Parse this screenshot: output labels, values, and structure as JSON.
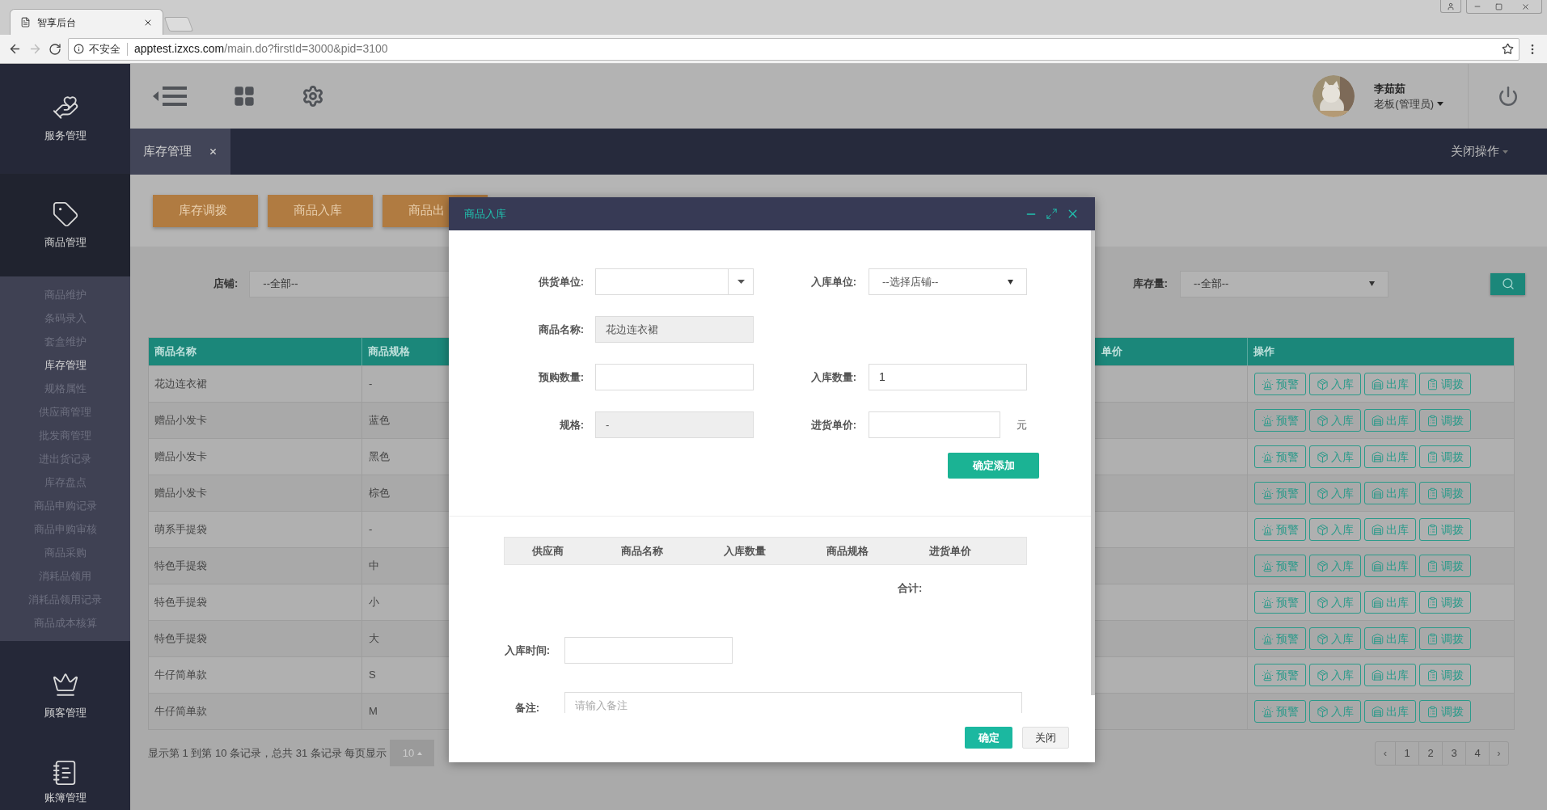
{
  "browser": {
    "tab_title": "智享后台",
    "security": "不安全",
    "url_host": "apptest.izxcs.com",
    "url_path": "/main.do?firstId=3000&pid=3100"
  },
  "sidebar": [
    {
      "label": "服务管理",
      "kind": "service",
      "expanded": false
    },
    {
      "label": "商品管理",
      "kind": "goods",
      "expanded": true,
      "children": [
        {
          "label": "商品维护",
          "selected": false
        },
        {
          "label": "条码录入",
          "selected": false
        },
        {
          "label": "套盒维护",
          "selected": false
        },
        {
          "label": "库存管理",
          "selected": true
        },
        {
          "label": "规格属性",
          "selected": false
        },
        {
          "label": "供应商管理",
          "selected": false
        },
        {
          "label": "批发商管理",
          "selected": false
        },
        {
          "label": "进出货记录",
          "selected": false
        },
        {
          "label": "库存盘点",
          "selected": false
        },
        {
          "label": "商品申购记录",
          "selected": false
        },
        {
          "label": "商品申购审核",
          "selected": false
        },
        {
          "label": "商品采购",
          "selected": false
        },
        {
          "label": "消耗品领用",
          "selected": false
        },
        {
          "label": "消耗品领用记录",
          "selected": false
        },
        {
          "label": "商品成本核算",
          "selected": false
        }
      ]
    },
    {
      "label": "顾客管理",
      "kind": "customer",
      "expanded": false
    },
    {
      "label": "账簿管理",
      "kind": "ledger",
      "expanded": false
    }
  ],
  "header": {
    "user_name": "李茹茹",
    "user_role": "老板(管理员)"
  },
  "tabs": [
    {
      "label": "库存管理",
      "selected": true
    }
  ],
  "close_ops": "关闭操作",
  "toolbar_buttons": [
    "库存调拨",
    "商品入库",
    "商品出"
  ],
  "filters": [
    {
      "label": "店铺:",
      "value": "--全部--"
    },
    {
      "label": "库存量:",
      "value": "--全部--"
    }
  ],
  "table": {
    "columns": [
      "商品名称",
      "商品规格",
      "单价",
      "操作"
    ],
    "rows": [
      {
        "name": "花边连衣裙",
        "spec": "-",
        "actions": [
          "预警",
          "入库",
          "出库",
          "调拨"
        ]
      },
      {
        "name": "赠品小发卡",
        "spec": "蓝色",
        "actions": [
          "预警",
          "入库",
          "出库",
          "调拨"
        ]
      },
      {
        "name": "赠品小发卡",
        "spec": "黑色",
        "actions": [
          "预警",
          "入库",
          "出库",
          "调拨"
        ]
      },
      {
        "name": "赠品小发卡",
        "spec": "棕色",
        "actions": [
          "预警",
          "入库",
          "出库",
          "调拨"
        ]
      },
      {
        "name": "萌系手提袋",
        "spec": "-",
        "actions": [
          "预警",
          "入库",
          "出库",
          "调拨"
        ]
      },
      {
        "name": "特色手提袋",
        "spec": "中",
        "actions": [
          "预警",
          "入库",
          "出库",
          "调拨"
        ]
      },
      {
        "name": "特色手提袋",
        "spec": "小",
        "actions": [
          "预警",
          "入库",
          "出库",
          "调拨"
        ]
      },
      {
        "name": "特色手提袋",
        "spec": "大",
        "actions": [
          "预警",
          "入库",
          "出库",
          "调拨"
        ]
      },
      {
        "name": "牛仔简单款",
        "spec": "S",
        "actions": [
          "预警",
          "入库",
          "出库",
          "调拨"
        ]
      },
      {
        "name": "牛仔简单款",
        "spec": "M",
        "actions": [
          "预警",
          "入库",
          "出库",
          "调拨"
        ]
      }
    ]
  },
  "pagination": {
    "summary": "显示第 1 到第 10 条记录，总共 31 条记录 每页显示",
    "page_size": "10",
    "prev": "‹",
    "pages": [
      "1",
      "2",
      "3",
      "4"
    ],
    "next": "›"
  },
  "dialog": {
    "title": "商品入库",
    "form_rows": [
      [
        {
          "label": "供货单位:",
          "kind": "combo"
        },
        {
          "label": "入库单位:",
          "kind": "select",
          "value": "--选择店铺--"
        }
      ],
      [
        {
          "label": "商品名称:",
          "kind": "readonly",
          "value": "花边连衣裙"
        }
      ],
      [
        {
          "label": "预购数量:",
          "kind": "input"
        },
        {
          "label": "入库数量:",
          "kind": "input",
          "value": "1"
        }
      ],
      [
        {
          "label": "规格:",
          "kind": "readonly",
          "value": "-"
        },
        {
          "label": "进货单价:",
          "kind": "input",
          "suffix": "元"
        }
      ]
    ],
    "add_button": "确定添加",
    "list_columns": [
      "供应商",
      "商品名称",
      "入库数量",
      "商品规格",
      "进货单价"
    ],
    "total_label": "合计:",
    "time_label": "入库时间:",
    "note_label": "备注:",
    "note_placeholder": "请输入备注",
    "buttons": [
      {
        "label": "确定",
        "kind": "primary"
      },
      {
        "label": "关闭",
        "kind": "default"
      }
    ]
  }
}
